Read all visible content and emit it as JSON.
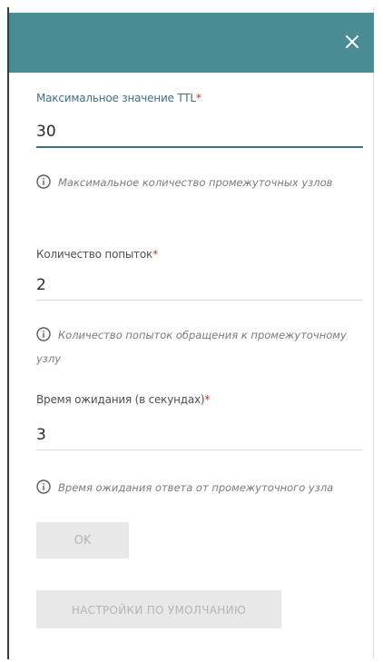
{
  "dialog": {
    "close_icon": "close-icon",
    "header_color": "#4a8c94",
    "accent_color": "#3f6f85"
  },
  "fields": [
    {
      "label": "Максимальное значение TTL",
      "required_mark": "*",
      "value": "30",
      "hint": "Максимальное количество промежуточных узлов"
    },
    {
      "label": "Количество попыток",
      "required_mark": "*",
      "value": "2",
      "hint": "Количество попыток обращения к промежуточному узлу"
    },
    {
      "label": "Время ожидания (в секундах)",
      "required_mark": "*",
      "value": "3",
      "hint": "Время ожидания ответа от промежуточного узла"
    }
  ],
  "buttons": {
    "ok": "OK",
    "defaults": "НАСТРОЙКИ ПО УМОЛЧАНИЮ"
  }
}
